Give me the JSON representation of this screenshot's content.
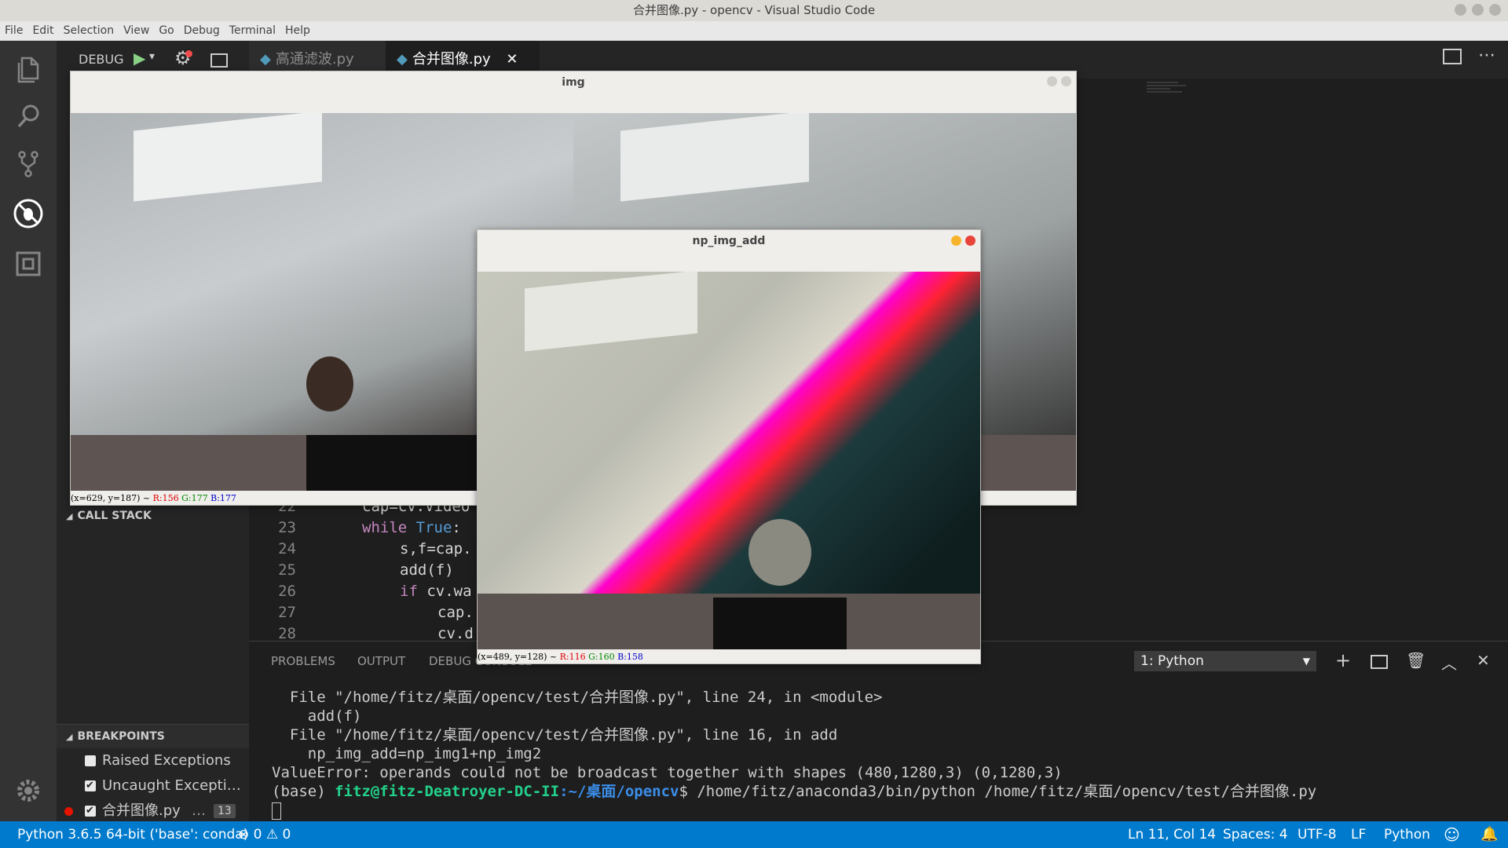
{
  "window": {
    "title": "合并图像.py - opencv - Visual Studio Code"
  },
  "menu": [
    "File",
    "Edit",
    "Selection",
    "View",
    "Go",
    "Debug",
    "Terminal",
    "Help"
  ],
  "debug": {
    "label": "DEBUG"
  },
  "tabs": [
    {
      "label": "高通滤波.py",
      "active": false
    },
    {
      "label": "合并图像.py",
      "active": true
    }
  ],
  "sidebar": {
    "call_stack": "CALL STACK",
    "breakpoints": "BREAKPOINTS",
    "bp_items": [
      {
        "label": "Raised Exceptions",
        "checked": false
      },
      {
        "label": "Uncaught Excepti…",
        "checked": true
      },
      {
        "label": "合并图像.py",
        "checked": true,
        "extra": "…",
        "badge": "13"
      }
    ]
  },
  "code": [
    {
      "n": "22",
      "text": "cap=cv.Video"
    },
    {
      "n": "23",
      "kw": "while",
      "kw2": "True",
      "text": ":"
    },
    {
      "n": "24",
      "text": "s,f=cap."
    },
    {
      "n": "25",
      "text": "add(f)"
    },
    {
      "n": "26",
      "kw": "if",
      "text": "cv.wa"
    },
    {
      "n": "27",
      "text": "cap."
    },
    {
      "n": "28",
      "text": "cv.d"
    }
  ],
  "panel": {
    "tabs": [
      "PROBLEMS",
      "OUTPUT",
      "DEBUG CONSOLE"
    ],
    "terminal_select": "1: Python",
    "lines": [
      "  File \"/home/fitz/桌面/opencv/test/合并图像.py\", line 24, in <module>",
      "    add(f)",
      "  File \"/home/fitz/桌面/opencv/test/合并图像.py\", line 16, in add",
      "    np_img_add=np_img1+np_img2",
      "ValueError: operands could not be broadcast together with shapes (480,1280,3) (0,1280,3)"
    ],
    "prompt": {
      "env": "(base) ",
      "user": "fitz@fitz-Deatroyer-DC-II",
      "path": ":~/桌面/opencv",
      "cmd": "$ /home/fitz/anaconda3/bin/python /home/fitz/桌面/opencv/test/合并图像.py"
    }
  },
  "status": {
    "interpreter": "Python 3.6.5 64-bit ('base': conda)",
    "errors": "0",
    "warnings": "0",
    "position": "Ln 11, Col 14",
    "spaces": "Spaces: 4",
    "encoding": "UTF-8",
    "eol": "LF",
    "language": "Python"
  },
  "cv_img": {
    "title": "img",
    "status_coords": "(x=629, y=187) ~ ",
    "r": "R:156",
    "g": "G:177",
    "b": "B:177"
  },
  "cv_add": {
    "title": "np_img_add",
    "status_coords": "(x=489, y=128) ~ ",
    "r": "R:116",
    "g": "G:160",
    "b": "B:158"
  },
  "colors": {
    "accent": "#007acc",
    "activity": "#333333",
    "sidebar": "#252526",
    "editor": "#1e1e1e"
  }
}
